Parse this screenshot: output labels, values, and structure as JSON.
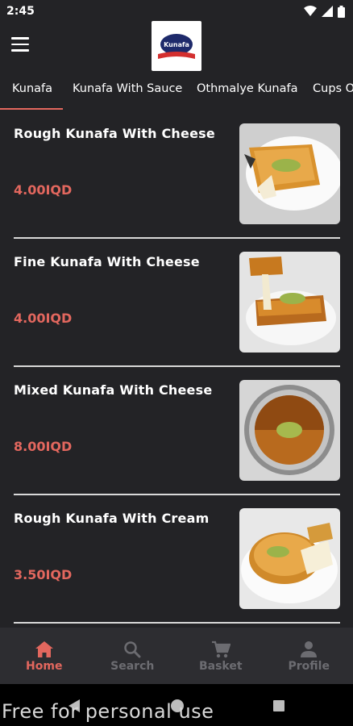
{
  "status_bar": {
    "time": "2:45"
  },
  "header": {
    "logo_text": "Kunafa"
  },
  "tabs": [
    {
      "label": "Kunafa",
      "active": true
    },
    {
      "label": "Kunafa With Sauce"
    },
    {
      "label": "Othmalye Kunafa"
    },
    {
      "label": "Cups O"
    }
  ],
  "items": [
    {
      "name": "Rough Kunafa With Cheese",
      "price": "4.00IQD"
    },
    {
      "name": "Fine Kunafa With Cheese",
      "price": "4.00IQD"
    },
    {
      "name": "Mixed Kunafa With Cheese",
      "price": "8.00IQD"
    },
    {
      "name": "Rough Kunafa With Cream",
      "price": "3.50IQD"
    }
  ],
  "bottom_nav": [
    {
      "label": "Home",
      "icon": "home-icon",
      "active": true
    },
    {
      "label": "Search",
      "icon": "search-icon"
    },
    {
      "label": "Basket",
      "icon": "cart-icon"
    },
    {
      "label": "Profile",
      "icon": "profile-icon"
    }
  ],
  "watermark": "Free for personal use",
  "colors": {
    "accent": "#e2675e",
    "background": "#232326",
    "nav_bg": "#2d2d31",
    "inactive": "#6c6c71"
  }
}
